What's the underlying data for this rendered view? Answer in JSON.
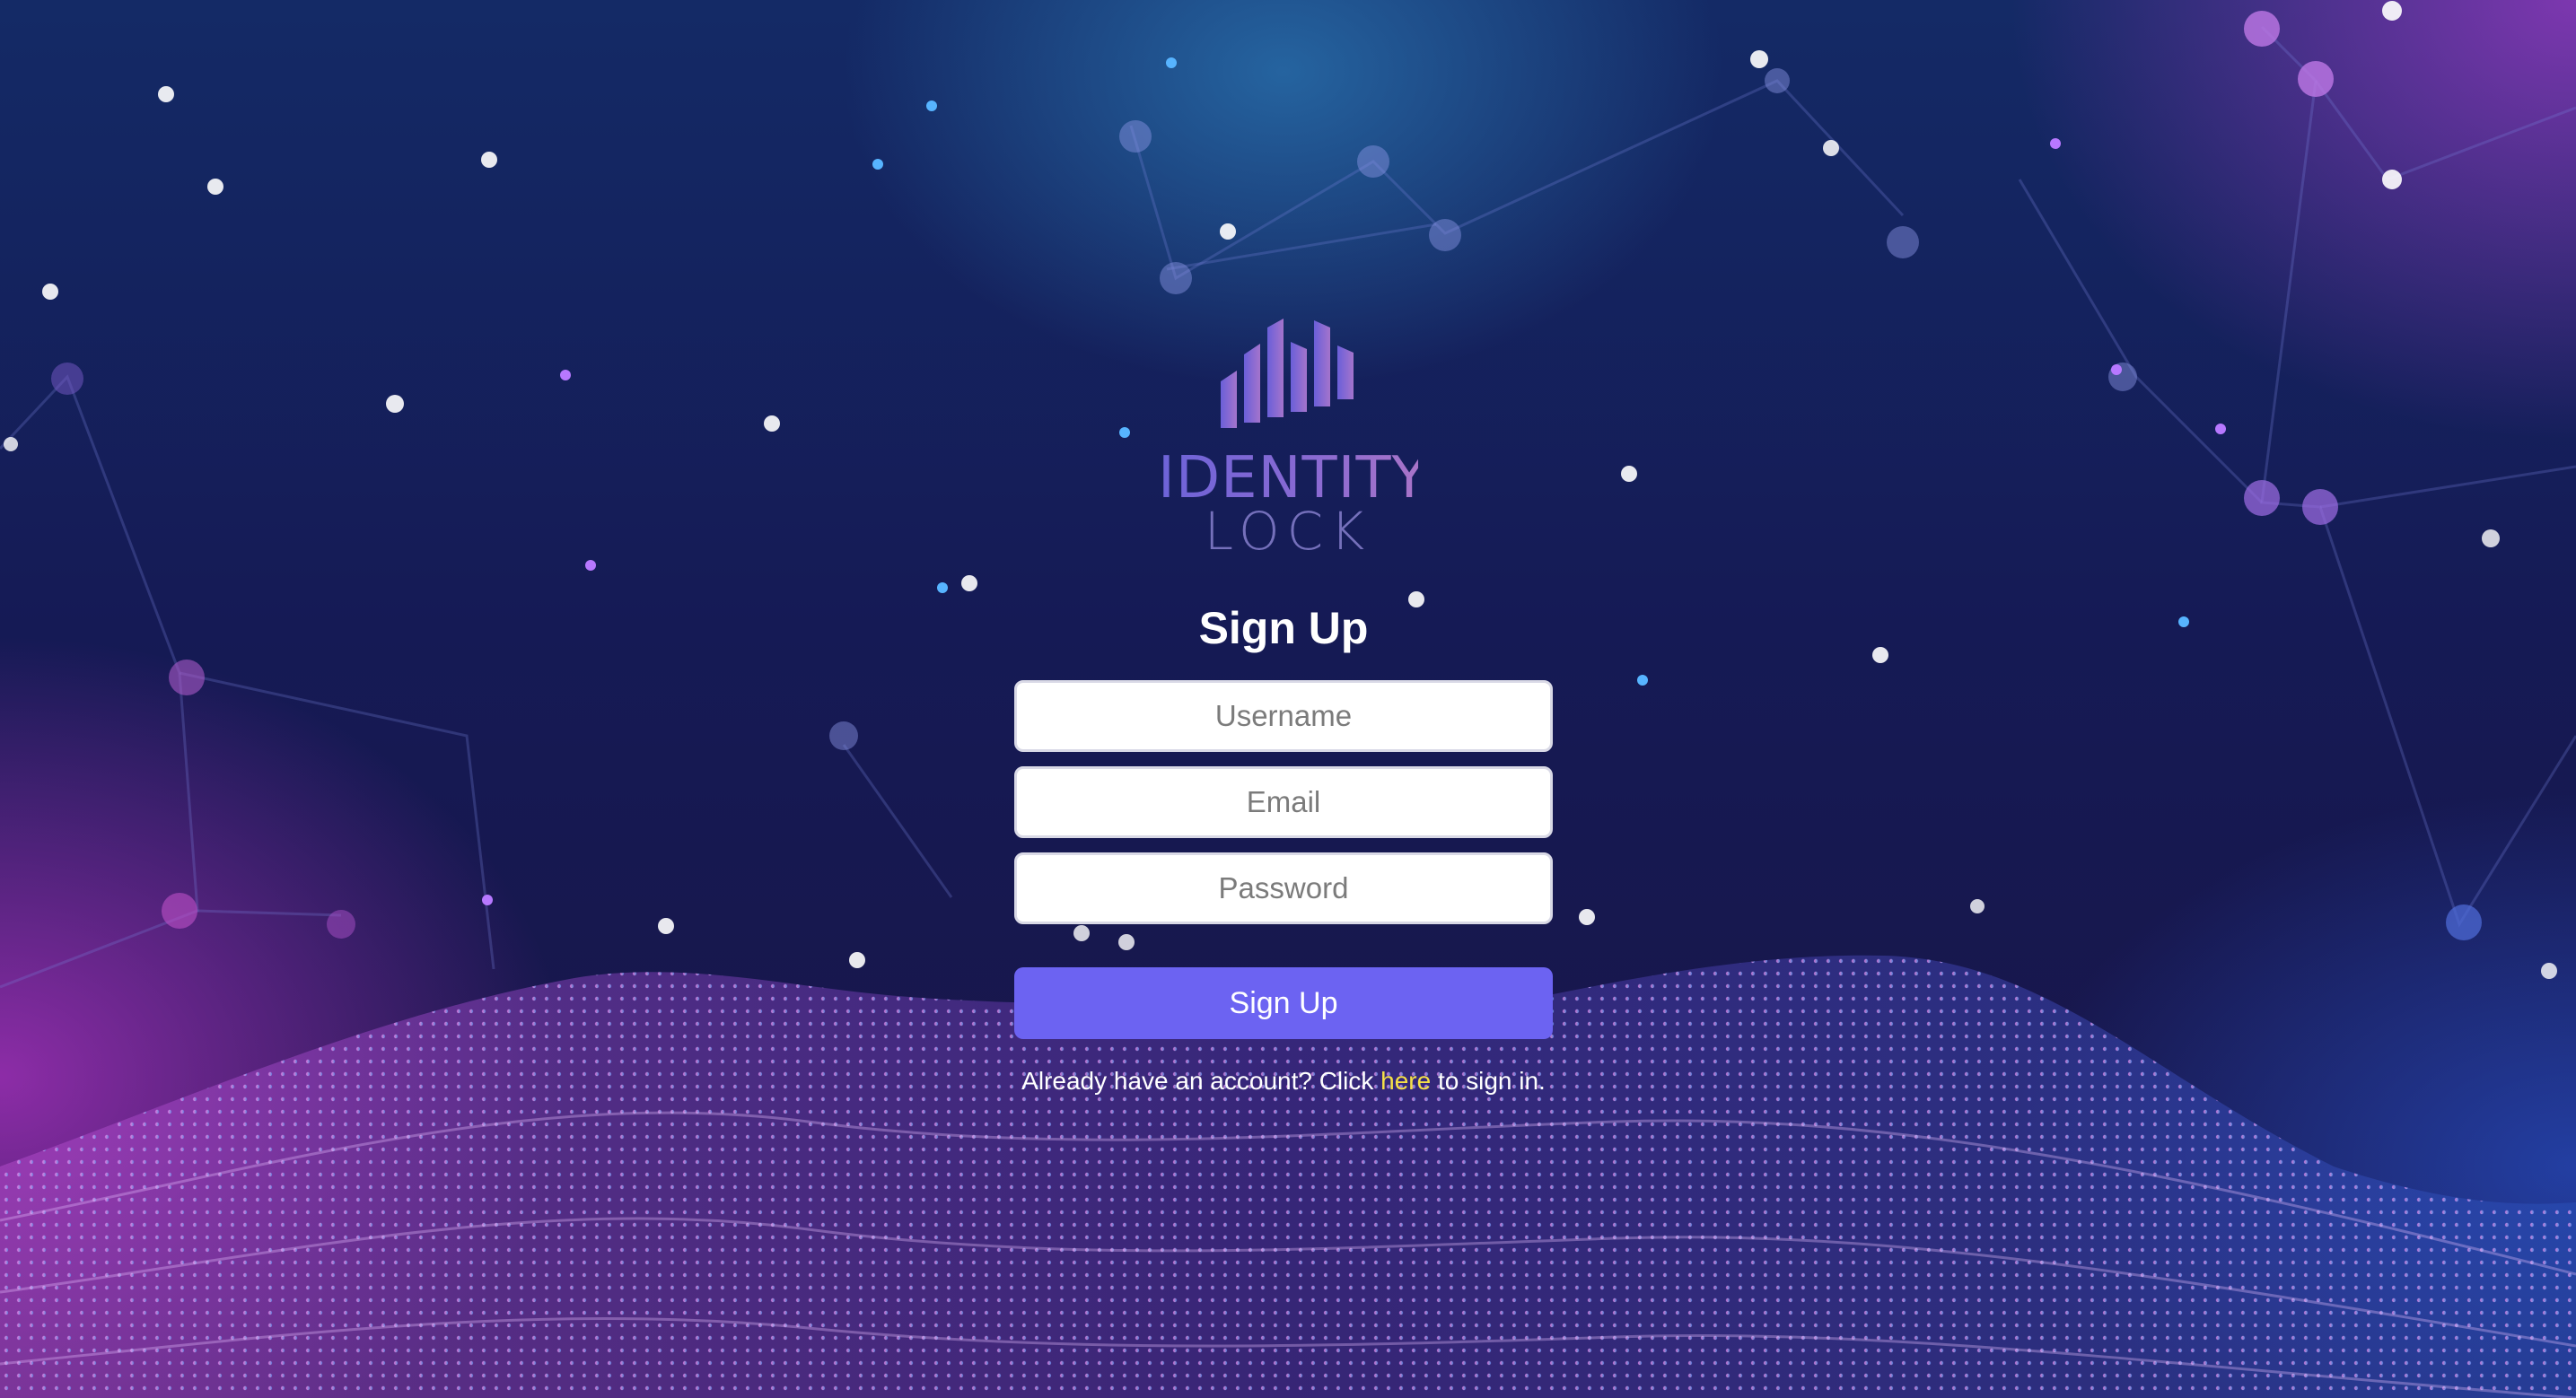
{
  "brand": {
    "line1": "IDENTITY",
    "line2": "LOCK",
    "logo_icon": "bar-chart-logo-icon"
  },
  "form": {
    "title": "Sign Up",
    "username_placeholder": "Username",
    "email_placeholder": "Email",
    "password_placeholder": "Password",
    "submit_label": "Sign Up"
  },
  "signin": {
    "prefix": "Already have an account? Click ",
    "link_text": "here",
    "suffix": " to sign in."
  },
  "colors": {
    "accent": "#6c63f2",
    "link": "#f5e048",
    "logo_gradient_start": "#6d63d8",
    "logo_gradient_end": "#a874c8"
  }
}
